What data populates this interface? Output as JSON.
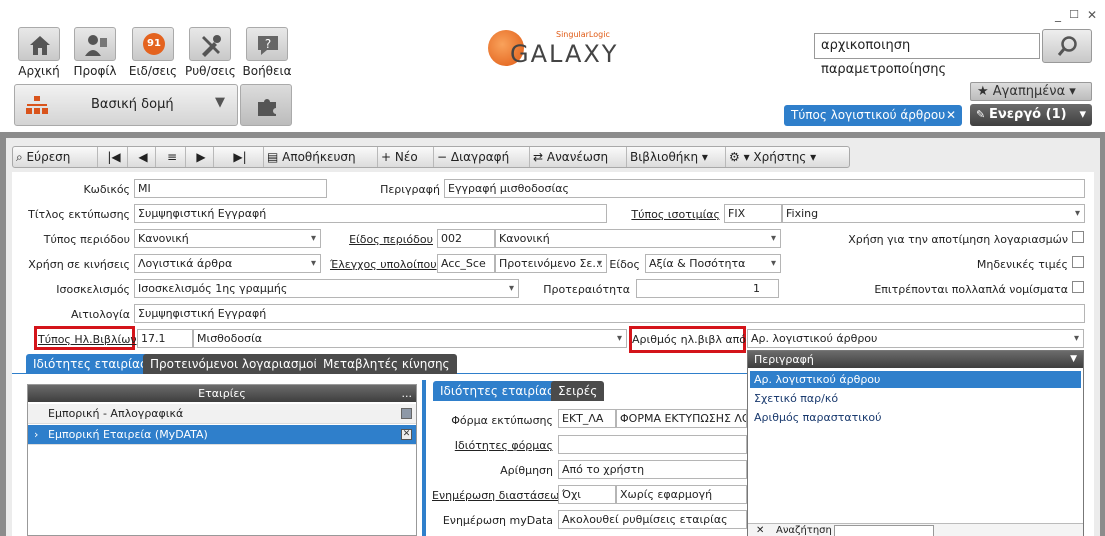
{
  "window": {
    "minimize": "_",
    "maximize": "☐",
    "close": "✕"
  },
  "nav": [
    {
      "label": "Αρχική",
      "icon": "home-icon"
    },
    {
      "label": "Προφίλ",
      "icon": "profile-icon"
    },
    {
      "label": "Ειδ/σεις",
      "icon": "notifications-icon",
      "badge": "91"
    },
    {
      "label": "Ρυθ/σεις",
      "icon": "settings-tools-icon"
    },
    {
      "label": "Βοήθεια",
      "icon": "help-icon"
    }
  ],
  "structure": {
    "label": "Βασική δομή"
  },
  "logo": {
    "brand": "SingularLogic",
    "word": "GALAXY",
    "g": "G",
    "rest": "alaxy"
  },
  "search": {
    "value": "αρχικοποιηση παραμετροποίησης"
  },
  "favorites": {
    "label": "★ Αγαπημένα ▾"
  },
  "open_tab": {
    "label": "Τύπος λογιστικού άρθρου",
    "close": "✕"
  },
  "active": {
    "label": "Ενεργό (1)"
  },
  "toolbar": {
    "find": "Εύρεση",
    "save": "Αποθήκευση",
    "new": "Νέο",
    "delete": "Διαγραφή",
    "refresh": "Ανανέωση",
    "library": "Βιβλιοθήκη",
    "users": "Χρήστης"
  },
  "form": {
    "code_label": "Κωδικός",
    "code_value": "ΜΙ",
    "desc_label": "Περιγραφή",
    "desc_value": "Εγγραφή μισθοδοσίας",
    "print_title_label": "Τίτλος εκτύπωσης",
    "print_title_value": "Συμψηφιστική Εγγραφή",
    "parity_label": "Τύπος ισοτιμίας",
    "parity_code": "FIX",
    "parity_value": "Fixing",
    "period_type_label": "Τύπος περιόδου",
    "period_type_value": "Κανονική",
    "period_kind_label": "Είδος περιόδου",
    "period_kind_code": "002",
    "period_kind_value": "Κανονική",
    "account_eval_label": "Χρήση για την αποτίμηση λογαριασμών",
    "usage_label": "Χρήση σε κινήσεις",
    "usage_value": "Λογιστικά άρθρα",
    "balance_check_label": "Έλεγχος υπολοίπου",
    "balance_check_code": "Acc_Sce",
    "balance_check_value": "Προτεινόμενο Σε...",
    "kind_label": "Είδος",
    "kind_value": "Αξία & Ποσότητα",
    "zero_label": "Μηδενικές τιμές",
    "balancing_label": "Ισοσκελισμός",
    "balancing_value": "Ισοσκελισμός 1ης γραμμής",
    "priority_label": "Προτεραιότητα",
    "priority_value": "1",
    "multi_currency_label": "Επιτρέπονται πολλαπλά νομίσματα",
    "reason_label": "Αιτιολογία",
    "reason_value": "Συμψηφιστική Εγγραφή",
    "book_type_label": "Τύπος Ηλ.Βιβλίων",
    "book_type_code": "17.1",
    "book_type_value": "Μισθοδοσία",
    "book_num_label": "Αριθμός ηλ.βιβλ από",
    "book_num_value": "Αρ. λογιστικού άρθρου"
  },
  "tabs": [
    "Ιδιότητες εταιρίας",
    "Προτεινόμενοι λογαριασμοί",
    "Μεταβλητές κίνησης"
  ],
  "grid": {
    "header": "Εταιρίες",
    "more": "...",
    "rows": [
      {
        "name": "Εμπορική - Απλογραφικά"
      },
      {
        "name": "Εμπορική Εταιρεία (MyDATA)"
      }
    ]
  },
  "subtabs": [
    "Ιδιότητες εταιρίας",
    "Σειρές"
  ],
  "sub": {
    "print_form_label": "Φόρμα εκτύπωσης",
    "print_form_code": "ΕΚΤ_ΛΑ",
    "print_form_value": "ΦΟΡΜΑ ΕΚΤΥΠΩΣΗΣ ΛΟΓ.",
    "form_props_label": "Ιδιότητες φόρμας",
    "numbering_label": "Αρίθμηση",
    "numbering_value": "Από το χρήστη",
    "dims_label": "Ενημέρωση διαστάσεων",
    "dims_code": "Όχι",
    "dims_value": "Χωρίς εφαρμογή",
    "mydata_label": "Ενημέρωση myData",
    "mydata_value": "Ακολουθεί ρυθμίσεις εταιρίας"
  },
  "popup": {
    "header": "Περιγραφή",
    "items": [
      "Αρ. λογιστικού άρθρου",
      "Σχετικό παρ/κό",
      "Αριθμός παραστατικού"
    ],
    "search_label": "Αναζήτηση"
  }
}
